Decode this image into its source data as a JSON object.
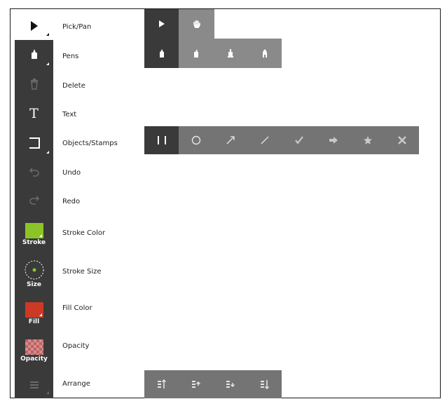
{
  "rows": [
    {
      "label": "Pick/Pan"
    },
    {
      "label": "Pens"
    },
    {
      "label": "Delete"
    },
    {
      "label": "Text"
    },
    {
      "label": "Objects/Stamps"
    },
    {
      "label": "Undo"
    },
    {
      "label": "Redo"
    },
    {
      "label": "Stroke Color"
    },
    {
      "label": "Stroke Size"
    },
    {
      "label": "Fill Color"
    },
    {
      "label": "Opacity"
    },
    {
      "label": "Arrange"
    }
  ],
  "toolbar": {
    "stroke_caption": "Stroke",
    "size_caption": "Size",
    "fill_caption": "Fill",
    "opacity_caption": "Opacity",
    "text_glyph": "T",
    "stroke_color": "#8cc428",
    "fill_color": "#cc3a24",
    "opacity_color": "#d88c8c"
  },
  "icons": {
    "pick": "cursor-icon",
    "pan": "hand-icon",
    "pens": [
      "pen-icon",
      "marker-icon",
      "highlighter-icon",
      "brush-icon"
    ],
    "objects": [
      "rectangle-icon",
      "circle-icon",
      "arrow-icon",
      "line-icon",
      "check-stamp-icon",
      "arrow-stamp-icon",
      "star-stamp-icon",
      "cross-stamp-icon"
    ],
    "arrange": [
      "bring-front-icon",
      "bring-forward-icon",
      "send-backward-icon",
      "send-back-icon"
    ]
  }
}
